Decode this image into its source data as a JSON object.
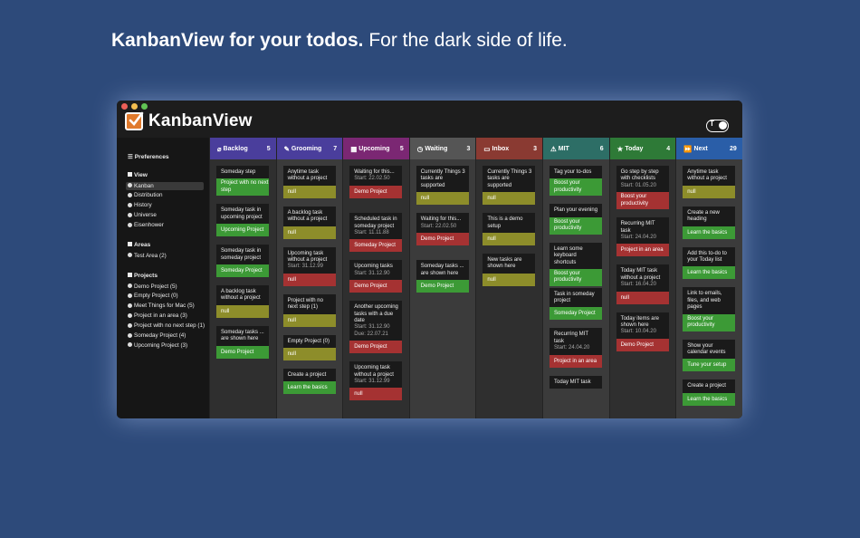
{
  "headline": {
    "bold": "KanbanView for your todos.",
    "rest": "For the dark side of life."
  },
  "app": {
    "title": "KanbanView",
    "toggle_letter": "T"
  },
  "colors": {
    "background": "#2d4a7a",
    "tag_green": "#3c9a36",
    "tag_olive": "#8d8d2a",
    "tag_red": "#a53232",
    "tag_brown": "#8a3a32"
  },
  "sidebar": {
    "preferences": "Preferences",
    "view_label": "View",
    "views": [
      "Kanban",
      "Distribution",
      "History",
      "Universe",
      "Eisenhower"
    ],
    "selected_view": "Kanban",
    "areas_label": "Areas",
    "areas": [
      "Test Area (2)"
    ],
    "projects_label": "Projects",
    "projects": [
      "Demo Project (5)",
      "Empty Project (0)",
      "Meet Things for Mac (5)",
      "Project in an area (3)",
      "Project with no next step (1)",
      "Someday Project (4)",
      "Upcoming Project (3)"
    ]
  },
  "columns": [
    {
      "name": "Backlog",
      "count": "5",
      "icon": "paperclip-icon",
      "color": "#4a3e9c",
      "cards": [
        {
          "title": "Someday step",
          "tag": "Project with no next step",
          "tag_color": "#3c9a36"
        },
        {
          "title": "Someday task in upcoming project",
          "tag": "Upcoming Project",
          "tag_color": "#3c9a36"
        },
        {
          "title": "Someday task in someday project",
          "tag": "Someday Project",
          "tag_color": "#3c9a36"
        },
        {
          "title": "A backlog task without a project",
          "tag": "null",
          "tag_color": "#8d8d2a"
        },
        {
          "title": "Someday tasks ... are shown here",
          "tag": "Demo Project",
          "tag_color": "#3c9a36"
        }
      ]
    },
    {
      "name": "Grooming",
      "count": "7",
      "icon": "brush-icon",
      "color": "#4a3e9c",
      "cards": [
        {
          "title": "Anytime task without a project",
          "tag": "null",
          "tag_color": "#8d8d2a"
        },
        {
          "title": "A backlog task without a project",
          "tag": "null",
          "tag_color": "#8d8d2a"
        },
        {
          "title": "Upcoming task without a project",
          "sub": "Start: 31.12.99",
          "tag": "null",
          "tag_color": "#a53232"
        },
        {
          "title": "Project with no next step (1)",
          "tag": "null",
          "tag_color": "#8d8d2a"
        },
        {
          "title": "Empty Project (0)",
          "tag": "null",
          "tag_color": "#8d8d2a"
        },
        {
          "title": "Create a project",
          "tag": "Learn the basics",
          "tag_color": "#3c9a36"
        }
      ]
    },
    {
      "name": "Upcoming",
      "count": "5",
      "icon": "calendar-icon",
      "color": "#7b2773",
      "cards": [
        {
          "title": "Waiting for this...",
          "sub": "Start: 22.02.50",
          "tag": "Demo Project",
          "tag_color": "#a53232"
        },
        {
          "title": "Scheduled task in someday project",
          "sub": "Start: 11.11.88",
          "tag": "Someday Project",
          "tag_color": "#a53232"
        },
        {
          "title": "Upcoming tasks",
          "sub": "Start: 31.12.90",
          "tag": "Demo Project",
          "tag_color": "#a53232"
        },
        {
          "title": "Another upcoming tasks with a due date",
          "sub": "Start: 31.12.90\nDue: 22.07.21",
          "tag": "Demo Project",
          "tag_color": "#a53232"
        },
        {
          "title": "Upcoming task without a project",
          "sub": "Start: 31.12.99",
          "tag": "null",
          "tag_color": "#a53232"
        }
      ]
    },
    {
      "name": "Waiting",
      "count": "3",
      "icon": "clock-icon",
      "color": "#555555",
      "cards": [
        {
          "title": "Currently Things 3 tasks are supported",
          "tag": "null",
          "tag_color": "#8d8d2a"
        },
        {
          "title": "Waiting for this...",
          "sub": "Start: 22.02.50",
          "tag": "Demo Project",
          "tag_color": "#a53232"
        },
        {
          "title": "Someday tasks ... are shown here",
          "tag": "Demo Project",
          "tag_color": "#3c9a36"
        }
      ]
    },
    {
      "name": "Inbox",
      "count": "3",
      "icon": "inbox-icon",
      "color": "#8a3a32",
      "cards": [
        {
          "title": "Currently Things 3 tasks are supported",
          "tag": "null",
          "tag_color": "#8d8d2a"
        },
        {
          "title": "This is a demo setup",
          "tag": "null",
          "tag_color": "#8d8d2a"
        },
        {
          "title": "New tasks are shown here",
          "tag": "null",
          "tag_color": "#8d8d2a"
        }
      ]
    },
    {
      "name": "MIT",
      "count": "6",
      "icon": "warning-icon",
      "color": "#2d6e66",
      "cards": [
        {
          "title": "Tag your to-dos",
          "tag": "Boost your productivity",
          "tag_color": "#3c9a36"
        },
        {
          "title": "Plan your evening",
          "tag": "Boost your productivity",
          "tag_color": "#3c9a36"
        },
        {
          "title": "Learn some keyboard shortcuts",
          "tag": "Boost your productivity",
          "tag_color": "#3c9a36"
        },
        {
          "title": "Task in someday project",
          "tag": "Someday Project",
          "tag_color": "#3c9a36"
        },
        {
          "title": "Recurring MIT task",
          "sub": "Start: 24.04.20",
          "tag": "Project in an area",
          "tag_color": "#a53232"
        },
        {
          "title": "Today MIT task",
          "tag": "",
          "tag_color": "#1a1a1a"
        }
      ]
    },
    {
      "name": "Today",
      "count": "4",
      "icon": "star-icon",
      "color": "#2e7a37",
      "cards": [
        {
          "title": "Go step by step with checklists",
          "sub": "Start: 01.05.20",
          "tag": "Boost your productivity",
          "tag_color": "#a53232"
        },
        {
          "title": "Recurring MIT task",
          "sub": "Start: 24.04.20",
          "tag": "Project in an area",
          "tag_color": "#a53232"
        },
        {
          "title": "Today MIT task without a project",
          "sub": "Start: 16.04.20",
          "tag": "null",
          "tag_color": "#a53232"
        },
        {
          "title": "Today items are shown here",
          "sub": "Start: 10.04.20",
          "tag": "Demo Project",
          "tag_color": "#a53232"
        }
      ]
    },
    {
      "name": "Next",
      "count": "29",
      "icon": "forward-icon",
      "color": "#2a5ea8",
      "cards": [
        {
          "title": "Anytime task without a project",
          "tag": "null",
          "tag_color": "#8d8d2a"
        },
        {
          "title": "Create a new heading",
          "tag": "Learn the basics",
          "tag_color": "#3c9a36"
        },
        {
          "title": "Add this to-do to your Today list",
          "tag": "Learn the basics",
          "tag_color": "#3c9a36"
        },
        {
          "title": "Link to emails, files, and web pages",
          "tag": "Boost your productivity",
          "tag_color": "#3c9a36"
        },
        {
          "title": "Show your calendar events",
          "tag": "Tune your setup",
          "tag_color": "#3c9a36"
        },
        {
          "title": "Create a project",
          "tag": "Learn the basics",
          "tag_color": "#3c9a36"
        }
      ]
    }
  ]
}
